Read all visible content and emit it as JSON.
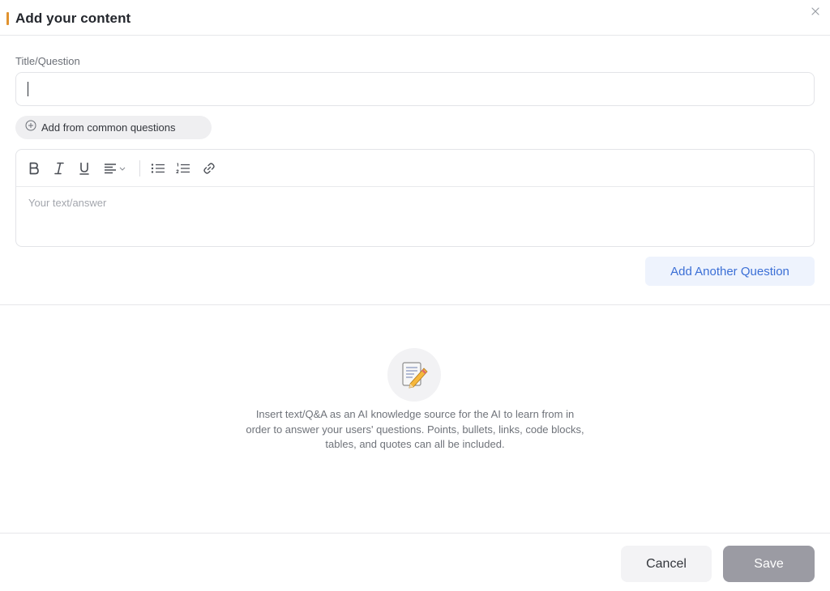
{
  "dialog": {
    "title": "Add your content",
    "accent_color": "#e0922f",
    "close_icon": "close-icon"
  },
  "form": {
    "title_label": "Title/Question",
    "title_value": "",
    "common_questions_button": "Add from common questions",
    "editor": {
      "toolbar": [
        "bold-icon",
        "italic-icon",
        "underline-icon",
        "align-icon",
        "bullet-list-icon",
        "numbered-list-icon",
        "link-icon"
      ],
      "placeholder": "Your text/answer"
    },
    "add_another_button": "Add Another Question"
  },
  "empty_state": {
    "icon": "memo-pencil-icon",
    "text": "Insert text/Q&A as an AI knowledge source for the AI to learn from in order to answer your users' questions. Points, bullets, links, code blocks, tables, and quotes can all be included."
  },
  "footer": {
    "cancel_label": "Cancel",
    "save_label": "Save"
  },
  "colors": {
    "primary_blue": "#3b6fd6",
    "save_disabled": "#9b9ba3"
  }
}
